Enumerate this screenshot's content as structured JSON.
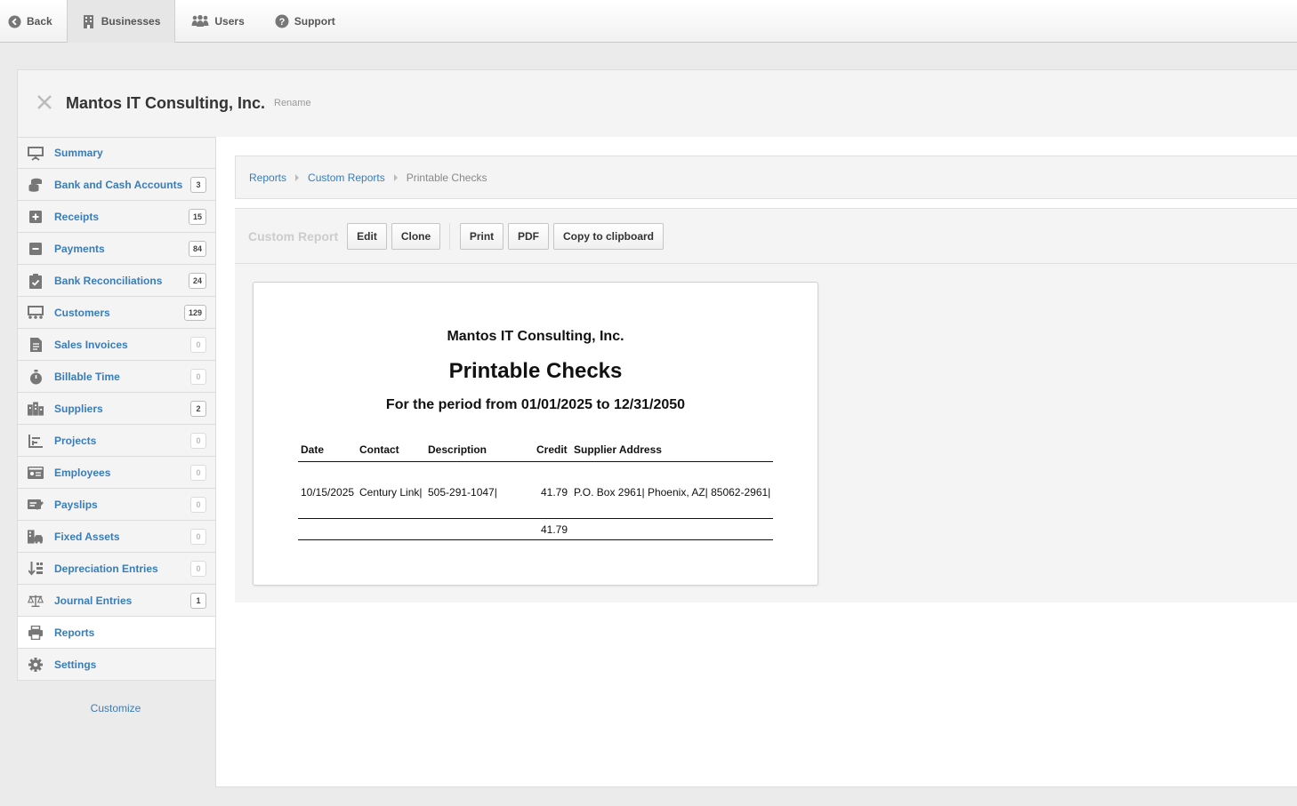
{
  "topnav": {
    "back": "Back",
    "businesses": "Businesses",
    "users": "Users",
    "support": "Support"
  },
  "business": {
    "name": "Mantos IT Consulting, Inc.",
    "rename": "Rename"
  },
  "sidebar": {
    "items": [
      {
        "label": "Summary",
        "icon": "summary-icon"
      },
      {
        "label": "Bank and Cash Accounts",
        "badge": "3",
        "icon": "coins-icon"
      },
      {
        "label": "Receipts",
        "badge": "15",
        "icon": "plus-square-icon"
      },
      {
        "label": "Payments",
        "badge": "84",
        "icon": "minus-square-icon"
      },
      {
        "label": "Bank Reconciliations",
        "badge": "24",
        "icon": "clipboard-check-icon"
      },
      {
        "label": "Customers",
        "badge": "129",
        "icon": "customers-icon"
      },
      {
        "label": "Sales Invoices",
        "badge": "0",
        "icon": "document-icon"
      },
      {
        "label": "Billable Time",
        "badge": "0",
        "icon": "stopwatch-icon"
      },
      {
        "label": "Suppliers",
        "badge": "2",
        "icon": "buildings-icon"
      },
      {
        "label": "Projects",
        "badge": "0",
        "icon": "bar-chart-icon"
      },
      {
        "label": "Employees",
        "badge": "0",
        "icon": "id-card-icon"
      },
      {
        "label": "Payslips",
        "badge": "0",
        "icon": "payslip-icon"
      },
      {
        "label": "Fixed Assets",
        "badge": "0",
        "icon": "building-car-icon"
      },
      {
        "label": "Depreciation Entries",
        "badge": "0",
        "icon": "sort-down-icon"
      },
      {
        "label": "Journal Entries",
        "badge": "1",
        "icon": "scale-icon"
      },
      {
        "label": "Reports",
        "icon": "printer-icon"
      },
      {
        "label": "Settings",
        "icon": "gear-icon"
      }
    ],
    "customize": "Customize"
  },
  "breadcrumb": {
    "reports": "Reports",
    "custom_reports": "Custom Reports",
    "current": "Printable Checks"
  },
  "toolbar": {
    "label": "Custom Report",
    "edit": "Edit",
    "clone": "Clone",
    "print": "Print",
    "pdf": "PDF",
    "copy": "Copy to clipboard"
  },
  "report": {
    "company": "Mantos IT Consulting, Inc.",
    "title": "Printable Checks",
    "period": "For the period from 01/01/2025 to 12/31/2050",
    "columns": {
      "date": "Date",
      "contact": "Contact",
      "description": "Description",
      "credit": "Credit",
      "supplier_address": "Supplier Address"
    },
    "rows": [
      {
        "date": "10/15/2025",
        "contact": "Century Link|",
        "description": "505-291-1047|",
        "credit": "41.79",
        "supplier_address": "P.O. Box 2961| Phoenix, AZ| 85062-2961|"
      }
    ],
    "total_credit": "41.79"
  },
  "colors": {
    "link": "#3a7cb8",
    "panel": "#f4f4f4",
    "border": "#dcdcdc"
  }
}
